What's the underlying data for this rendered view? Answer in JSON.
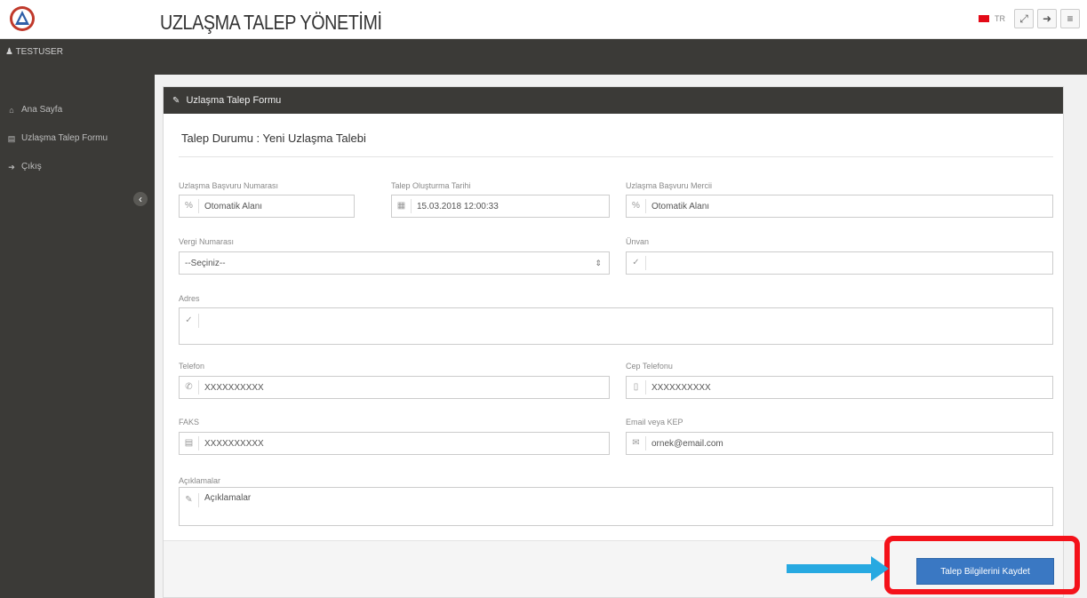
{
  "header": {
    "title": "UZLAŞMA TALEP YÖNETİMİ",
    "lang": "TR",
    "icons": [
      "fullscreen-icon",
      "logout-icon",
      "menu-icon"
    ]
  },
  "user": {
    "name": "TESTUSER"
  },
  "sidebar": {
    "items": [
      {
        "label": "Ana Sayfa",
        "icon": "home-icon"
      },
      {
        "label": "Uzlaşma Talep Formu",
        "icon": "document-icon"
      },
      {
        "label": "Çıkış",
        "icon": "exit-icon"
      }
    ]
  },
  "panel": {
    "title": "Uzlaşma Talep Formu",
    "status": "Talep Durumu : Yeni Uzlaşma Talebi"
  },
  "form": {
    "basvuru_no": {
      "label": "Uzlaşma Başvuru Numarası",
      "value": "Otomatik Alanı"
    },
    "tarih": {
      "label": "Talep Oluşturma Tarihi",
      "value": "15.03.2018 12:00:33"
    },
    "merci": {
      "label": "Uzlaşma Başvuru Mercii",
      "value": "Otomatik Alanı"
    },
    "vergi_no": {
      "label": "Vergi Numarası",
      "value": "--Seçiniz--"
    },
    "unvan": {
      "label": "Ünvan",
      "value": ""
    },
    "adres": {
      "label": "Adres",
      "value": ""
    },
    "telefon": {
      "label": "Telefon",
      "value": "XXXXXXXXXX"
    },
    "cep": {
      "label": "Cep Telefonu",
      "value": "XXXXXXXXXX"
    },
    "faks": {
      "label": "FAKS",
      "value": "XXXXXXXXXX"
    },
    "email": {
      "label": "Email veya KEP",
      "value": "ornek@email.com"
    },
    "aciklamalar": {
      "label": "Açıklamalar",
      "placeholder": "Açıklamalar"
    }
  },
  "actions": {
    "save_label": "Talep Bilgilerini Kaydet"
  },
  "colors": {
    "sidebar": "#3b3a37",
    "primary": "#3a78c3",
    "highlight": "#f4121a",
    "arrow": "#27a9e1"
  }
}
